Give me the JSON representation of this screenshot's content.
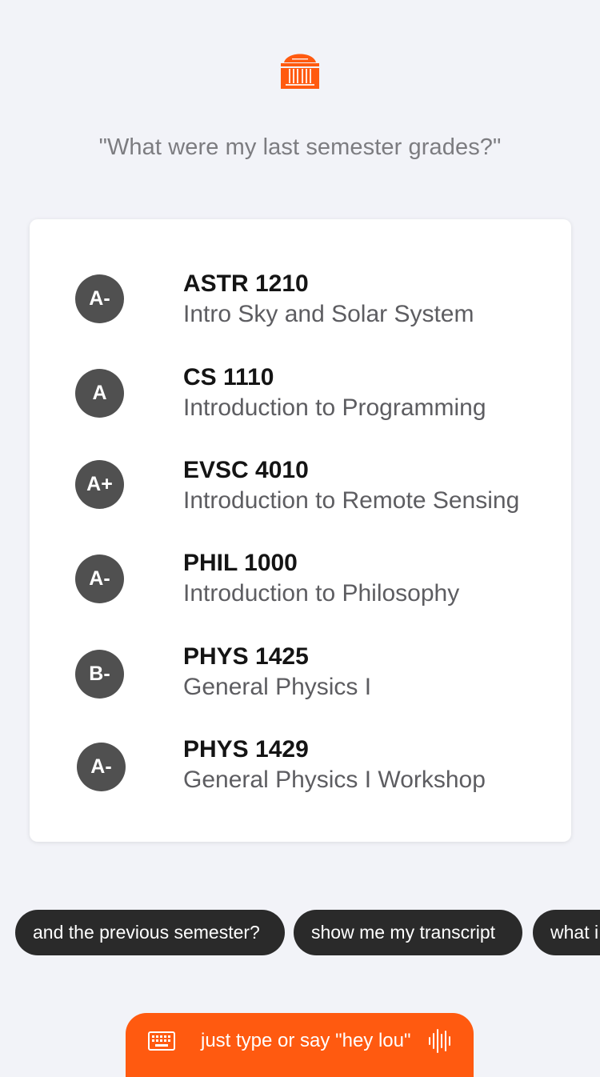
{
  "question": "\"What were my last semester grades?\"",
  "courses": [
    {
      "grade": "A-",
      "code": "ASTR 1210",
      "name": "Intro Sky and Solar System"
    },
    {
      "grade": "A",
      "code": "CS 1110",
      "name": "Introduction to Programming"
    },
    {
      "grade": "A+",
      "code": "EVSC 4010",
      "name": "Introduction to Remote Sensing"
    },
    {
      "grade": "A-",
      "code": "PHIL 1000",
      "name": "Introduction to Philosophy"
    },
    {
      "grade": "B-",
      "code": "PHYS 1425",
      "name": "General Physics I"
    },
    {
      "grade": "A-",
      "code": "PHYS 1429",
      "name": "General Physics I Workshop"
    }
  ],
  "suggestions": [
    "and the previous semester?",
    "show me my transcript",
    "what i"
  ],
  "input_bar": {
    "label": "just type or say \"hey lou\"",
    "keyboard_icon": "keyboard-icon",
    "voice_icon": "voice-wave-icon"
  },
  "logo_icon": "rotunda-logo-icon",
  "colors": {
    "accent": "#ff5a10",
    "badge": "#505050",
    "chip": "#2a2a2a",
    "background": "#f2f3f8"
  }
}
